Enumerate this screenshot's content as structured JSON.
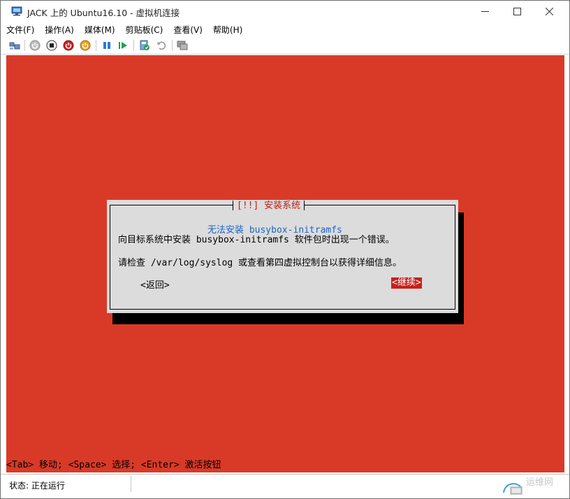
{
  "window": {
    "title": "JACK 上的 Ubuntu16.10 - 虚拟机连接"
  },
  "menu": {
    "items": [
      "文件(F)",
      "操作(A)",
      "媒体(M)",
      "剪贴板(C)",
      "查看(V)",
      "帮助(H)"
    ]
  },
  "toolbar": {
    "icons": [
      "ctrl-alt-del-icon",
      "start-icon",
      "turn-off-icon",
      "shutdown-icon",
      "save-icon",
      "pause-icon",
      "resume-icon",
      "checkpoint-icon",
      "revert-icon",
      "enhanced-session-icon"
    ]
  },
  "vm": {
    "background_color": "#d93a27",
    "dialog": {
      "title": "[!!] 安装系统",
      "subtitle": "无法安装 busybox-initramfs",
      "line1": "向目标系统中安装 busybox-initramfs 软件包时出现一个错误。",
      "line2": "请检查 /var/log/syslog 或查看第四虚拟控制台以获得详细信息。",
      "back_label": "<返回>",
      "continue_label": "<继续>"
    },
    "hint": "<Tab> 移动; <Space> 选择; <Enter> 激活按钮"
  },
  "statusbar": {
    "status": "状态: 正在运行",
    "watermark": "运维网"
  }
}
